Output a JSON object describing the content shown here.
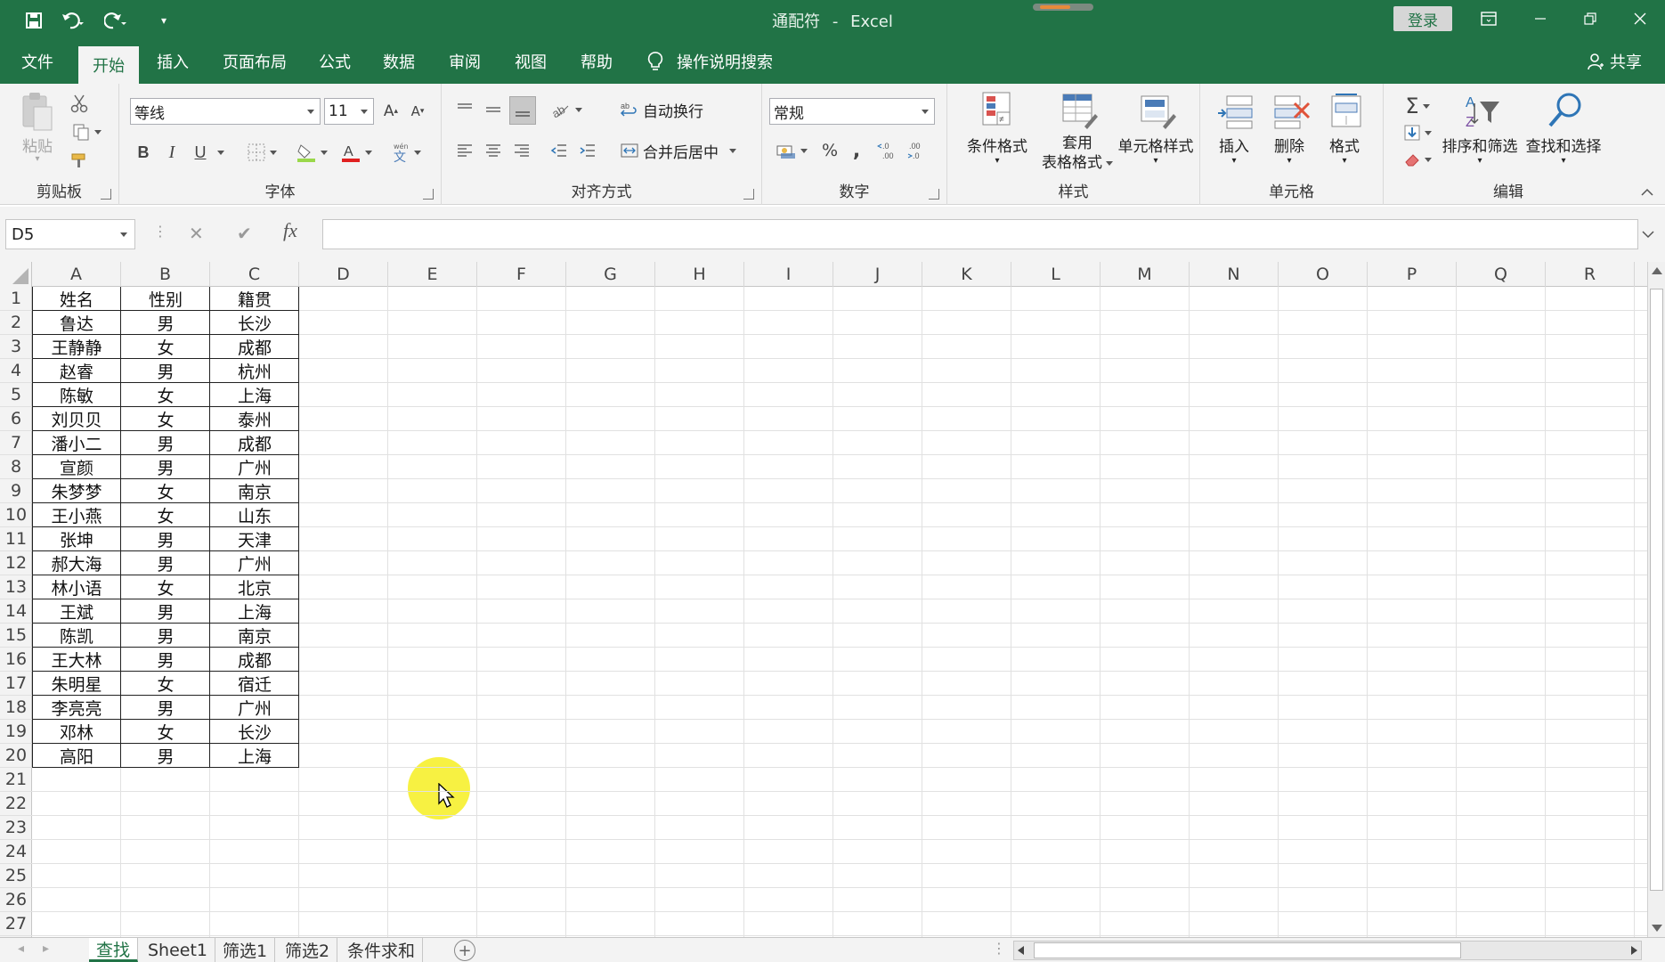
{
  "window": {
    "title": "通配符",
    "app": "Excel",
    "separator": "-",
    "login": "登录"
  },
  "menu": {
    "tabs": [
      "文件",
      "开始",
      "插入",
      "页面布局",
      "公式",
      "数据",
      "审阅",
      "视图",
      "帮助"
    ],
    "active": "开始",
    "tell_me": "操作说明搜索",
    "share": "共享"
  },
  "ribbon": {
    "clipboard": {
      "label": "剪贴板",
      "paste": "粘贴"
    },
    "font": {
      "label": "字体",
      "name": "等线",
      "size": "11",
      "bold": "B",
      "italic": "I",
      "underline": "U"
    },
    "alignment": {
      "label": "对齐方式",
      "wrap": "自动换行",
      "merge": "合并后居中"
    },
    "number": {
      "label": "数字",
      "format": "常规",
      "percent": "%",
      "comma": ","
    },
    "styles": {
      "label": "样式",
      "conditional": "条件格式",
      "table_line1": "套用",
      "table_line2": "表格格式",
      "cell_styles": "单元格样式"
    },
    "cells": {
      "label": "单元格",
      "insert": "插入",
      "delete": "删除",
      "format": "格式"
    },
    "editing": {
      "label": "编辑",
      "sum": "Σ",
      "sort": "排序和筛选",
      "find": "查找和选择"
    }
  },
  "formula_bar": {
    "name_box": "D5",
    "fx": "fx",
    "value": ""
  },
  "grid": {
    "columns": [
      "A",
      "B",
      "C",
      "D",
      "E",
      "F",
      "G",
      "H",
      "I",
      "J",
      "K",
      "L",
      "M",
      "N",
      "O",
      "P",
      "Q",
      "R"
    ],
    "row_numbers": [
      "1",
      "2",
      "3",
      "4",
      "5",
      "6",
      "7",
      "8",
      "9",
      "10",
      "11",
      "12",
      "13",
      "14",
      "15",
      "16",
      "17",
      "18",
      "19",
      "20",
      "21",
      "22",
      "23",
      "24",
      "25",
      "26",
      "27"
    ],
    "rows": [
      [
        "姓名",
        "性别",
        "籍贯"
      ],
      [
        "鲁达",
        "男",
        "长沙"
      ],
      [
        "王静静",
        "女",
        "成都"
      ],
      [
        "赵睿",
        "男",
        "杭州"
      ],
      [
        "陈敏",
        "女",
        "上海"
      ],
      [
        "刘贝贝",
        "女",
        "泰州"
      ],
      [
        "潘小二",
        "男",
        "成都"
      ],
      [
        "宣颜",
        "男",
        "广州"
      ],
      [
        "朱梦梦",
        "女",
        "南京"
      ],
      [
        "王小燕",
        "女",
        "山东"
      ],
      [
        "张坤",
        "男",
        "天津"
      ],
      [
        "郝大海",
        "男",
        "广州"
      ],
      [
        "林小语",
        "女",
        "北京"
      ],
      [
        "王斌",
        "男",
        "上海"
      ],
      [
        "陈凯",
        "男",
        "南京"
      ],
      [
        "王大林",
        "男",
        "成都"
      ],
      [
        "朱明星",
        "女",
        "宿迁"
      ],
      [
        "李亮亮",
        "男",
        "广州"
      ],
      [
        "邓林",
        "女",
        "长沙"
      ],
      [
        "高阳",
        "男",
        "上海"
      ]
    ]
  },
  "sheets": {
    "tabs": [
      "查找",
      "Sheet1",
      "筛选1",
      "筛选2",
      "条件求和"
    ],
    "active": "查找"
  },
  "colors": {
    "accent": "#217346",
    "highlight": "#f6ef2e"
  }
}
